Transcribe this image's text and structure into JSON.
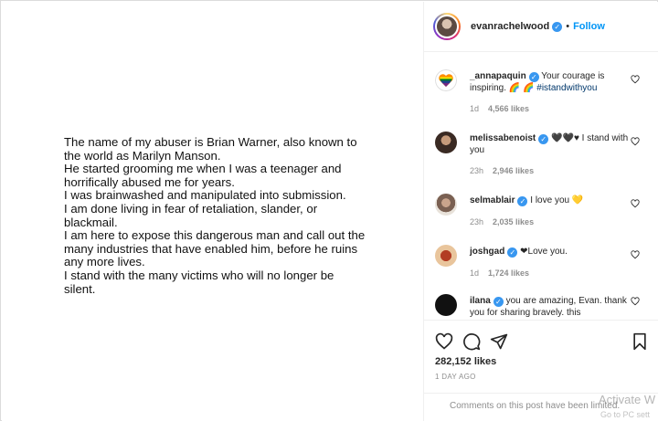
{
  "post": {
    "lines": [
      "The name of my abuser is Brian Warner, also known to the world as Marilyn Manson.",
      "He started grooming me when I was a teenager and horrifically abused me for years.",
      "I was brainwashed and manipulated into submission.",
      "I am done living in fear of retaliation, slander, or blackmail.",
      "I am here to expose this dangerous man and call out the many industries that have enabled him, before he ruins any more lives.",
      "I stand with the many victims who will no longer be silent."
    ]
  },
  "header": {
    "username": "evanrachelwood",
    "separator": "•",
    "follow_label": "Follow"
  },
  "comments": [
    {
      "user": "_annapaquin",
      "text": "Your courage is inspiring. 🌈 🌈",
      "hashtag": "#istandwithyou",
      "time": "1d",
      "likes": "4,566 likes"
    },
    {
      "user": "melissabenoist",
      "text": "🖤🖤♥ I stand with you",
      "hashtag": "",
      "time": "23h",
      "likes": "2,946 likes"
    },
    {
      "user": "selmablair",
      "text": "I love you 💛",
      "hashtag": "",
      "time": "23h",
      "likes": "2,035 likes"
    },
    {
      "user": "joshgad",
      "text": "❤Love you.",
      "hashtag": "",
      "time": "1d",
      "likes": "1,724 likes"
    },
    {
      "user": "ilana",
      "text": "you are amazing, Evan. thank you for sharing bravely. this",
      "hashtag": "",
      "time": "",
      "likes": ""
    }
  ],
  "footer": {
    "likes": "282,152 likes",
    "timestamp": "1 DAY AGO",
    "disabled_note": "Comments on this post have been limited."
  },
  "watermark": {
    "line1": "Activate W",
    "line2": "Go to PC sett"
  },
  "icons": {
    "like": "heart-outline-icon",
    "comment": "comment-bubble-icon",
    "share": "paper-plane-icon",
    "save": "bookmark-icon"
  },
  "colors": {
    "accent": "#0095f6",
    "verified": "#3897f0",
    "muted": "#8e8e8e",
    "hashtag": "#00376b"
  }
}
